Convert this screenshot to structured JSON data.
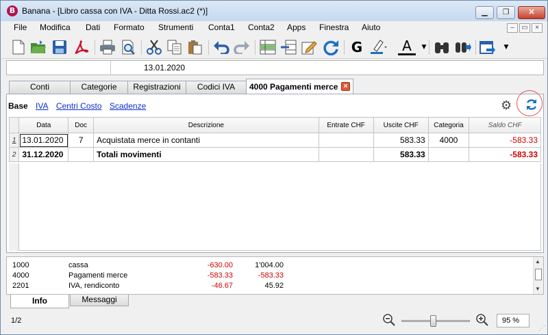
{
  "window": {
    "title": "Banana - [Libro cassa con IVA - Ditta Rossi.ac2 (*)]",
    "app_icon_letter": "B",
    "min_label": "▁",
    "restore_label": "❐",
    "close_label": "✕"
  },
  "menu": {
    "items": [
      "File",
      "Modifica",
      "Dati",
      "Formato",
      "Strumenti",
      "Conta1",
      "Conta2",
      "Apps",
      "Finestra",
      "Aiuto"
    ],
    "mdi_min": "–",
    "mdi_restore": "▭",
    "mdi_close": "×"
  },
  "toolbar": {
    "icons": [
      "new-document-icon",
      "open-folder-icon",
      "save-icon",
      "pdf-icon",
      "print-icon",
      "print-preview-icon",
      "cut-icon",
      "copy-icon",
      "paste-icon",
      "undo-icon",
      "redo-icon",
      "insert-row-icon",
      "delete-row-icon",
      "edit-icon",
      "recalculate-icon",
      "bold-icon",
      "highlight-color-icon",
      "font-color-icon",
      "find-icon",
      "find-next-icon",
      "export-icon"
    ],
    "bold_label": "G",
    "font_color_label": "A"
  },
  "cellbar": {
    "value": "13.01.2020"
  },
  "tabs": {
    "items": [
      "Conti",
      "Categorie",
      "Registrazioni",
      "Codici IVA"
    ],
    "active": "4000 Pagamenti merce",
    "active_close": "×"
  },
  "views": {
    "current": "Base",
    "links": [
      "IVA",
      "Centri Costo",
      "Scadenze"
    ]
  },
  "table": {
    "headers": [
      "Data",
      "Doc",
      "Descrizione",
      "Entrate CHF",
      "Uscite CHF",
      "Categoria",
      "Saldo CHF"
    ],
    "rows": [
      {
        "num": "1",
        "date": "13.01.2020",
        "doc": "7",
        "desc": "Acquistata merce in contanti",
        "in": "",
        "out": "583.33",
        "cat": "4000",
        "balance": "-583.33"
      },
      {
        "num": "2",
        "date": "31.12.2020",
        "doc": "",
        "desc": "Totali movimenti",
        "in": "",
        "out": "583.33",
        "cat": "",
        "balance": "-583.33"
      }
    ]
  },
  "info": {
    "rows": [
      {
        "code": "1000",
        "name": "cassa",
        "value1": "-630.00",
        "value2": "1'004.00"
      },
      {
        "code": "4000",
        "name": "Pagamenti merce",
        "value1": "-583.33",
        "value2": "-583.33"
      },
      {
        "code": "2201",
        "name": "IVA, rendiconto",
        "value1": "-46.67",
        "value2": "45.92"
      }
    ]
  },
  "bottom_tabs": {
    "active": "Info",
    "other": "Messaggi"
  },
  "status": {
    "left": "1/2",
    "zoom": "95 %"
  },
  "colors": {
    "negative": "#d10000",
    "link": "#0a2ecf",
    "accent": "#1a70c6"
  }
}
